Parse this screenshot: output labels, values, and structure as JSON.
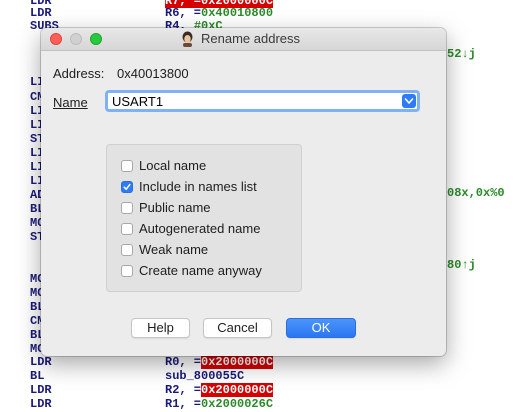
{
  "background_listing": {
    "top_lines": [
      {
        "mnemonic": "LDR",
        "ops_prefix": "R6, =",
        "ops_hex": "0x40010800",
        "highlight": false
      },
      {
        "mnemonic": "SUBS",
        "ops_prefix": "R4, ",
        "ops_hex": "#0xC",
        "highlight": false
      }
    ],
    "right_fragments": [
      "52↓j",
      "08x,0x%0",
      "80↑j"
    ],
    "bottom_lines": [
      {
        "mnemonic": "LDR",
        "ops_prefix": "R0, =",
        "ops_hex": "0x2000000C",
        "highlight": true
      },
      {
        "mnemonic": "BL",
        "ops_prefix": "sub_800055C",
        "ops_hex": "",
        "highlight": false
      },
      {
        "mnemonic": "LDR",
        "ops_prefix": "R2, =",
        "ops_hex": "0x2000000C",
        "highlight": true
      },
      {
        "mnemonic": "LDR",
        "ops_prefix": "R1, =",
        "ops_hex": "0x2000026C",
        "highlight": false
      }
    ],
    "left_fragments": [
      "LI",
      "CM",
      "LI",
      "LI",
      "ST",
      "LI",
      "LI",
      "LI",
      "AD",
      "BL",
      "MO",
      "ST",
      "MC",
      "MO",
      "BL",
      "CM",
      "BL",
      "MC"
    ]
  },
  "dialog": {
    "title": "Rename address",
    "address_label": "Address:",
    "address_value": "0x40013800",
    "name_label": "Name",
    "name_value": "USART1",
    "options": [
      {
        "label": "Local name",
        "checked": false
      },
      {
        "label": "Include in names list",
        "checked": true
      },
      {
        "label": "Public name",
        "checked": false
      },
      {
        "label": "Autogenerated name",
        "checked": false
      },
      {
        "label": "Weak name",
        "checked": false
      },
      {
        "label": "Create name anyway",
        "checked": false
      }
    ],
    "buttons": {
      "help": "Help",
      "cancel": "Cancel",
      "ok": "OK"
    }
  },
  "colors": {
    "accent": "#2f7bf5",
    "highlight_red": "#d60000",
    "listing_blue": "#1a1a7a",
    "listing_green": "#2a8a2a"
  }
}
